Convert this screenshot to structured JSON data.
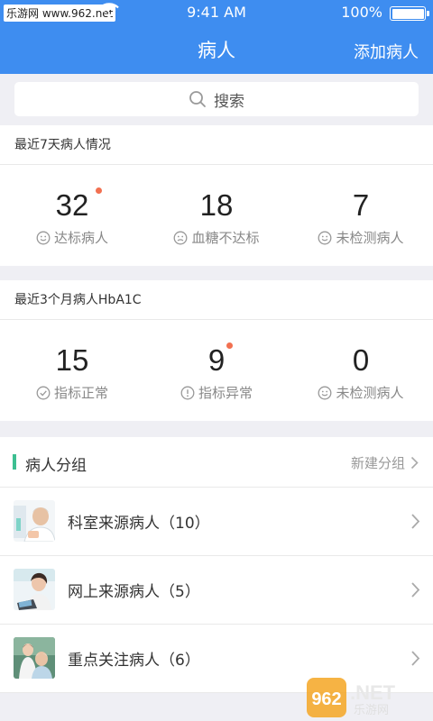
{
  "status_bar": {
    "carrier": "乐游网 www.962.net",
    "time": "9:41 AM",
    "battery": "100%"
  },
  "nav": {
    "title": "病人",
    "add_label": "添加病人"
  },
  "search": {
    "placeholder": "搜索"
  },
  "recent_week": {
    "title": "最近7天病人情况",
    "stats": [
      {
        "value": "32",
        "label": "达标病人",
        "icon": "smile-icon",
        "dot": true
      },
      {
        "value": "18",
        "label": "血糖不达标",
        "icon": "frown-icon",
        "dot": false
      },
      {
        "value": "7",
        "label": "未检测病人",
        "icon": "smile-icon",
        "dot": false
      }
    ]
  },
  "recent_months": {
    "title": "最近3个月病人HbA1C",
    "stats": [
      {
        "value": "15",
        "label": "指标正常",
        "icon": "check-circle-icon",
        "dot": false
      },
      {
        "value": "9",
        "label": "指标异常",
        "icon": "exclamation-circle-icon",
        "dot": true
      },
      {
        "value": "0",
        "label": "未检测病人",
        "icon": "smile-icon",
        "dot": false
      }
    ]
  },
  "groups": {
    "title": "病人分组",
    "new_label": "新建分组",
    "items": [
      {
        "label": "科室来源病人（10）",
        "avatar": "department-patients-avatar"
      },
      {
        "label": "网上来源病人（5）",
        "avatar": "online-patients-avatar"
      },
      {
        "label": "重点关注病人（6）",
        "avatar": "key-patients-avatar"
      }
    ]
  },
  "watermark": {
    "logo": "962.NET",
    "sub": "乐游网"
  },
  "colors": {
    "primary": "#3e8df0",
    "accent_green": "#3dbf91",
    "dot_red": "#f27050"
  }
}
